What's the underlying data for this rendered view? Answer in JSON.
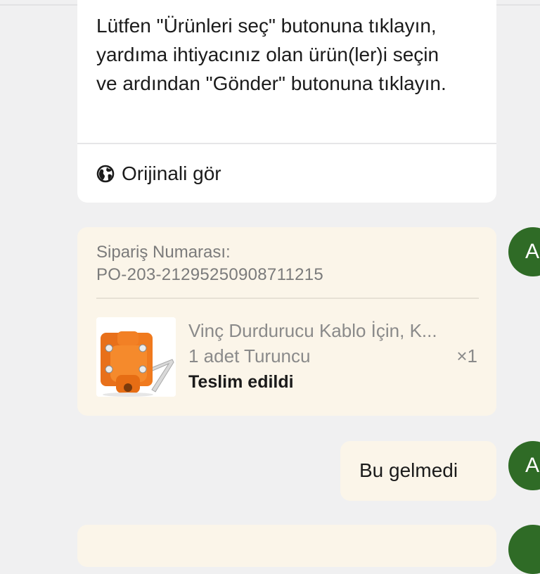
{
  "agent_message": {
    "text": "Lütfen \"Ürünleri seç\" butonuna tıklayın, yardıma ihtiyacınız olan ürün(ler)i seçin ve ardından \"Gönder\" butonuna tıklayın.",
    "view_original_label": "Orijinali gör",
    "view_original_icon": "globe-icon"
  },
  "order_card": {
    "order_label": "Sipariş Numarası:",
    "order_number": "PO-203-21295250908711215",
    "product": {
      "title": "Vinç Durdurucu Kablo İçin, K...",
      "variant": "1 adet Turuncu",
      "quantity": "×1",
      "status": "Teslim edildi",
      "image_icon": "orange-winch-stopper-image"
    }
  },
  "user_message": {
    "text": "Bu gelmedi"
  },
  "avatars": {
    "initial": "A",
    "color": "#2f6b26"
  },
  "colors": {
    "background": "#f0f0f1",
    "agent_bubble": "#ffffff",
    "user_bubble": "#fbf5e9",
    "product_orange": "#f07a1e"
  }
}
